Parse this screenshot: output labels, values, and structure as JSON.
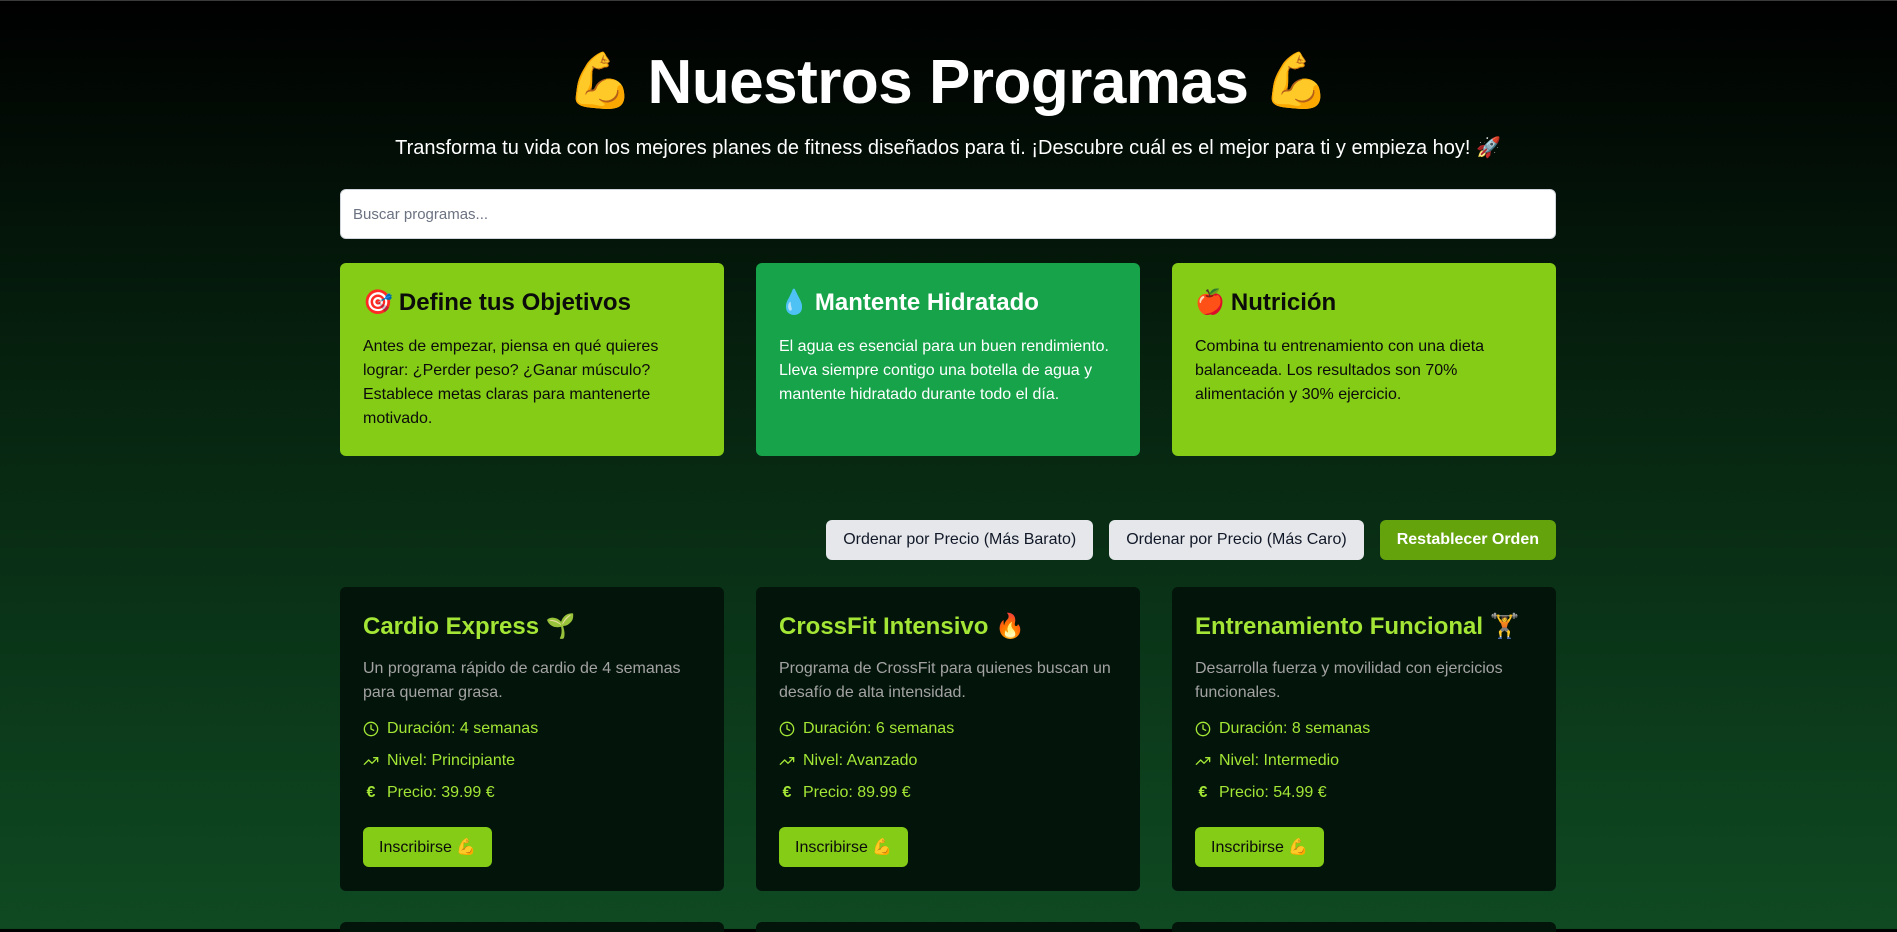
{
  "hero": {
    "emoji": "💪",
    "title": "Nuestros Programas",
    "subtitle": "Transforma tu vida con los mejores planes de fitness diseñados para ti. ¡Descubre cuál es el mejor para ti y empieza hoy! 🚀"
  },
  "search": {
    "placeholder": "Buscar programas..."
  },
  "tips": [
    {
      "emoji": "🎯",
      "title": "Define tus Objetivos",
      "text": "Antes de empezar, piensa en qué quieres lograr: ¿Perder peso? ¿Ganar músculo? Establece metas claras para mantenerte motivado.",
      "color": "#84cc16"
    },
    {
      "emoji": "💧",
      "title": "Mantente Hidratado",
      "text": "El agua es esencial para un buen rendimiento. Lleva siempre contigo una botella de agua y mantente hidratado durante todo el día.",
      "color": "#16a34a"
    },
    {
      "emoji": "🍎",
      "title": "Nutrición",
      "text": "Combina tu entrenamiento con una dieta balanceada. Los resultados son 70% alimentación y 30% ejercicio.",
      "color": "#84cc16"
    }
  ],
  "sort": {
    "cheap_label": "Ordenar por Precio (Más Barato)",
    "expensive_label": "Ordenar por Precio (Más Caro)",
    "reset_label": "Restablecer Orden"
  },
  "programs": [
    {
      "title": "Cardio Express 🌱",
      "description": "Un programa rápido de cardio de 4 semanas para quemar grasa.",
      "duration": "Duración: 4 semanas",
      "level": "Nivel: Principiante",
      "price": "Precio: 39.99 €",
      "button": "Inscribirse 💪"
    },
    {
      "title": "CrossFit Intensivo 🔥",
      "description": "Programa de CrossFit para quienes buscan un desafío de alta intensidad.",
      "duration": "Duración: 6 semanas",
      "level": "Nivel: Avanzado",
      "price": "Precio: 89.99 €",
      "button": "Inscribirse 💪"
    },
    {
      "title": "Entrenamiento Funcional 🏋️",
      "description": "Desarrolla fuerza y movilidad con ejercicios funcionales.",
      "duration": "Duración: 8 semanas",
      "level": "Nivel: Intermedio",
      "price": "Precio: 54.99 €",
      "button": "Inscribirse 💪"
    }
  ],
  "icons": {
    "duration": "clock-icon",
    "level": "trending-up-icon",
    "price": "euro-icon"
  },
  "colors": {
    "accent": "#a3e635",
    "lime": "#84cc16",
    "green": "#16a34a",
    "card_bg": "#03140a"
  }
}
